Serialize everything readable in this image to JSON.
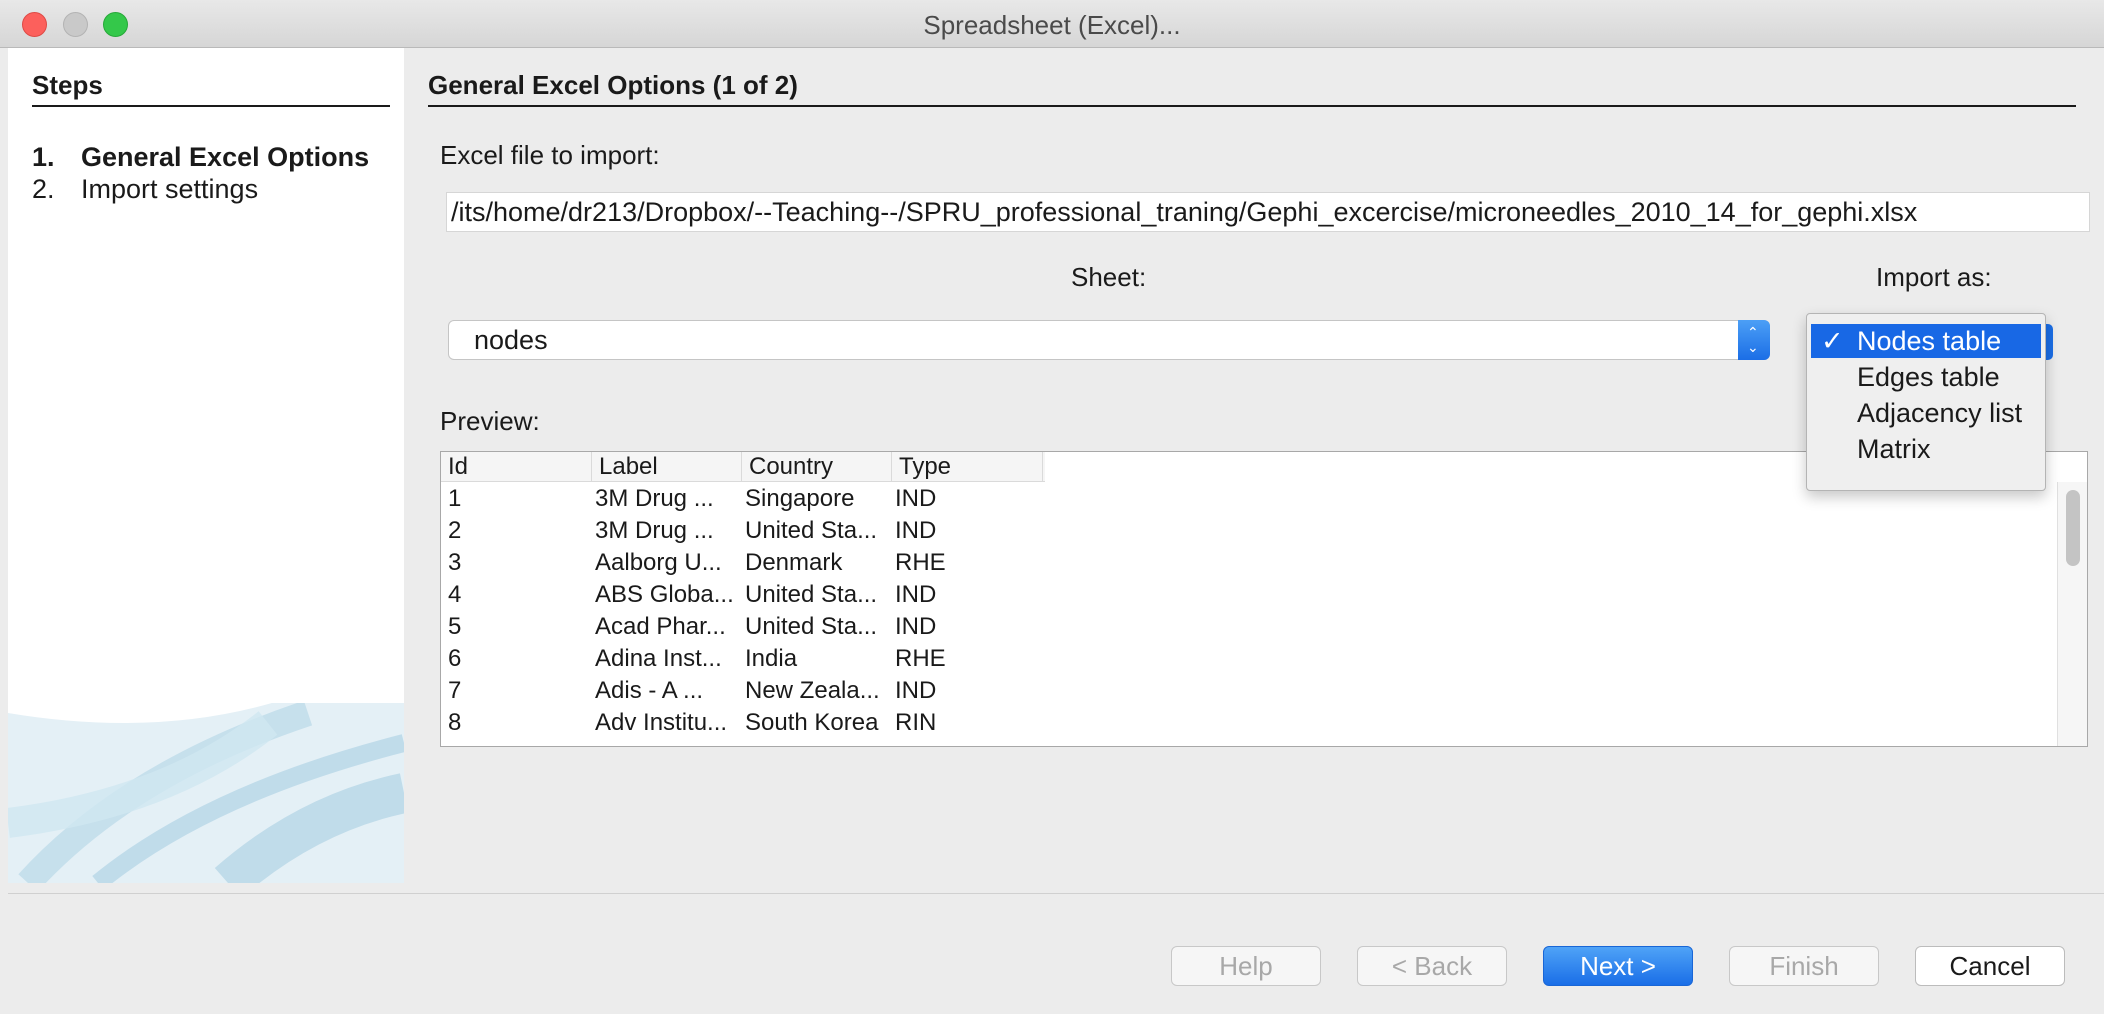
{
  "window": {
    "title": "Spreadsheet (Excel)..."
  },
  "steps": {
    "heading": "Steps",
    "items": [
      {
        "num": "1.",
        "label": "General Excel Options",
        "active": true
      },
      {
        "num": "2.",
        "label": "Import settings",
        "active": false
      }
    ]
  },
  "content": {
    "heading": "General Excel Options (1 of 2)",
    "file_label": "Excel file to import:",
    "file_path": "/its/home/dr213/Dropbox/--Teaching--/SPRU_professional_traning/Gephi_excercise/microneedles_2010_14_for_gephi.xlsx",
    "sheet_label": "Sheet:",
    "sheet_value": "nodes",
    "import_label": "Import as:",
    "preview_label": "Preview:"
  },
  "preview": {
    "columns": [
      "Id",
      "Label",
      "Country",
      "Type"
    ],
    "rows": [
      [
        "1",
        "3M Drug ...",
        "Singapore",
        "IND"
      ],
      [
        "2",
        "3M Drug ...",
        "United Sta...",
        "IND"
      ],
      [
        "3",
        "Aalborg U...",
        "Denmark",
        "RHE"
      ],
      [
        "4",
        "ABS Globa...",
        "United Sta...",
        "IND"
      ],
      [
        "5",
        "Acad Phar...",
        "United Sta...",
        "IND"
      ],
      [
        "6",
        "Adina Inst...",
        "India",
        "RHE"
      ],
      [
        "7",
        "Adis - A ...",
        "New Zeala...",
        "IND"
      ],
      [
        "8",
        "Adv Institu...",
        "South Korea",
        "RIN"
      ]
    ]
  },
  "import_dropdown": {
    "check": "✓",
    "options": [
      "Nodes table",
      "Edges table",
      "Adjacency list",
      "Matrix"
    ],
    "selected": "Nodes table"
  },
  "buttons": {
    "help": "Help",
    "back": "< Back",
    "next": "Next >",
    "finish": "Finish",
    "cancel": "Cancel"
  },
  "colors": {
    "accent": "#1868e5",
    "close": "#fc605c",
    "maximize": "#34c84a"
  }
}
